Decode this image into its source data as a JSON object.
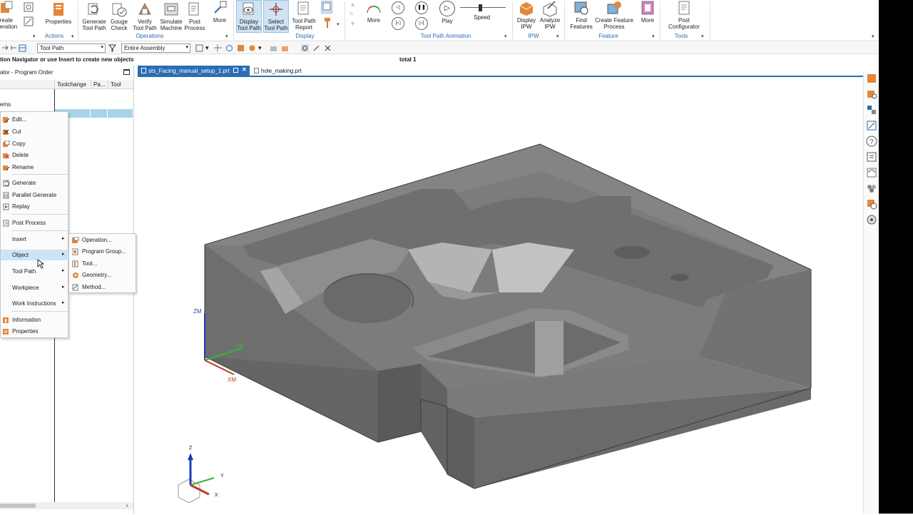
{
  "ribbon": {
    "buttons": [
      {
        "id": "create-operation",
        "label": "reate\neration"
      },
      {
        "id": "properties",
        "label": "Properties"
      },
      {
        "id": "generate",
        "label": "Generate\nTool Path"
      },
      {
        "id": "gouge",
        "label": "Gouge\nCheck"
      },
      {
        "id": "verify",
        "label": "Verify\nTool Path"
      },
      {
        "id": "simulate",
        "label": "Simulate\nMachine"
      },
      {
        "id": "post",
        "label": "Post\nProcess"
      },
      {
        "id": "more1",
        "label": "More"
      },
      {
        "id": "display-tp",
        "label": "Display\nTool Path"
      },
      {
        "id": "select-tp",
        "label": "Select\nTool Path"
      },
      {
        "id": "tp-report",
        "label": "Tool Path\nReport"
      },
      {
        "id": "more2",
        "label": "More"
      },
      {
        "id": "play",
        "label": "Play"
      },
      {
        "id": "speed",
        "label": "Speed"
      },
      {
        "id": "display-ipw",
        "label": "Display\nIPW"
      },
      {
        "id": "analyze-ipw",
        "label": "Analyze\nIPW"
      },
      {
        "id": "find-features",
        "label": "Find\nFeatures"
      },
      {
        "id": "create-feature",
        "label": "Create Feature\nProcess"
      },
      {
        "id": "more3",
        "label": "More"
      },
      {
        "id": "post-config",
        "label": "Post\nConfigurator"
      }
    ],
    "groups": {
      "actions": "Actions",
      "operations": "Operations",
      "display": "Display",
      "animation": "Tool Path Animation",
      "ipw": "IPW",
      "feature": "Feature",
      "tools": "Tools"
    }
  },
  "toolbar": {
    "type_filter": "Tool Path",
    "scope_filter": "Entire Assembly"
  },
  "hint": "tion Navigator or use Insert to create new objects",
  "total": "total 1",
  "navigator": {
    "title": "ator - Program Order",
    "columns": [
      "Toolchange",
      "Pa...",
      "Tool"
    ],
    "first_item": "ems"
  },
  "context_menu": {
    "items": [
      {
        "label": "Edit..."
      },
      {
        "label": "Cut"
      },
      {
        "label": "Copy"
      },
      {
        "label": "Delete"
      },
      {
        "label": "Rename"
      },
      {
        "label": "Generate"
      },
      {
        "label": "Parallel Generate"
      },
      {
        "label": "Replay"
      },
      {
        "label": "Post Process"
      },
      {
        "label": "Insert"
      },
      {
        "label": "Object"
      },
      {
        "label": "Tool Path"
      },
      {
        "label": "Workpiece"
      },
      {
        "label": "Work Instructions"
      },
      {
        "label": "Information"
      },
      {
        "label": "Properties"
      }
    ],
    "submenu": [
      "Operation...",
      "Program Group...",
      "Tool...",
      "Geometry...",
      "Method..."
    ]
  },
  "tabs": [
    {
      "label": "sts_Facing_manual_setup_1.prt"
    },
    {
      "label": "hole_making.prt"
    }
  ],
  "axes": {
    "zm": "ZM",
    "ym": "YM",
    "xm": "XM",
    "z": "Z",
    "y": "Y",
    "x": "X"
  },
  "colors": {
    "accent": "#2a6db3",
    "selection": "#a8d4ea",
    "menu_highlight": "#cce4f7",
    "part_gray": "#7a7a7a"
  }
}
